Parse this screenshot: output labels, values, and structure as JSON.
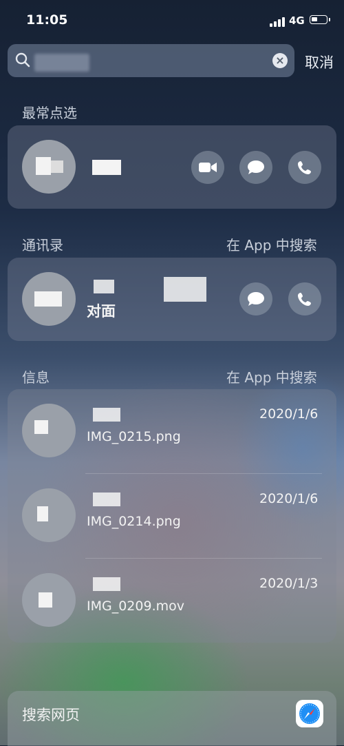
{
  "status_bar": {
    "time": "11:05",
    "network": "4G"
  },
  "search": {
    "cancel_label": "取消"
  },
  "sections": {
    "top_hits": {
      "title": "最常点选"
    },
    "contacts": {
      "title": "通讯录",
      "search_in_app": "在 App 中搜索",
      "name_partial": "对面"
    },
    "messages": {
      "title": "信息",
      "search_in_app": "在 App 中搜索",
      "items": [
        {
          "date": "2020/1/6",
          "attachment": "IMG_0215.png"
        },
        {
          "date": "2020/1/6",
          "attachment": "IMG_0214.png"
        },
        {
          "date": "2020/1/3",
          "attachment": "IMG_0209.mov"
        }
      ]
    },
    "web": {
      "label": "搜索网页"
    }
  },
  "icons": [
    "search-icon",
    "clear-icon",
    "video-icon",
    "message-icon",
    "phone-icon",
    "safari-icon"
  ]
}
